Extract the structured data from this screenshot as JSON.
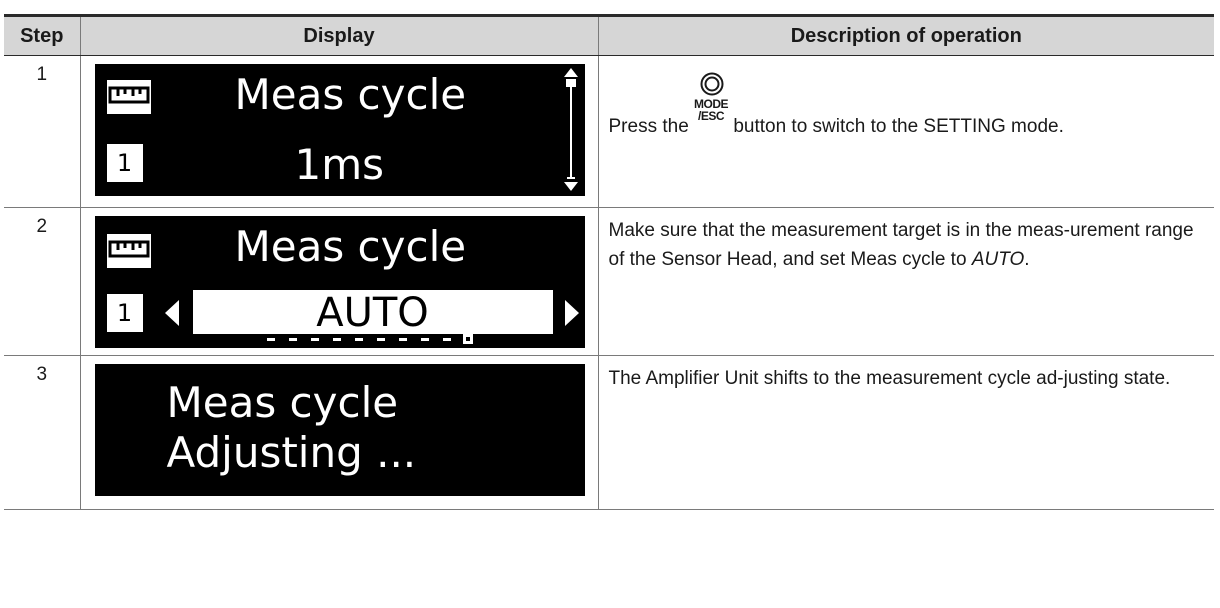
{
  "table": {
    "headers": {
      "step": "Step",
      "display": "Display",
      "description": "Description of operation"
    }
  },
  "rows": [
    {
      "step": "1",
      "lcd": {
        "title": "Meas cycle",
        "bank": "1",
        "value": "1ms"
      },
      "description": {
        "before": "Press the ",
        "button_top": "MODE",
        "button_bottom": "/ESC",
        "after": " button to switch to the SETTING mode."
      }
    },
    {
      "step": "2",
      "lcd": {
        "title": "Meas cycle",
        "bank": "1",
        "value": "AUTO"
      },
      "description": {
        "text": "Make sure that the measurement target is in the meas-urement range of the Sensor Head, and set Meas cycle to ",
        "emphasis": "AUTO",
        "end": "."
      }
    },
    {
      "step": "3",
      "lcd": {
        "line1": "Meas cycle",
        "line2": "Adjusting ..."
      },
      "description": {
        "text": "The Amplifier Unit shifts to the measurement cycle ad-justing state."
      }
    }
  ],
  "icons": [
    "ruler-icon",
    "scroll-bar-icon",
    "left-arrow-icon",
    "right-arrow-icon",
    "mode-esc-button-icon"
  ]
}
